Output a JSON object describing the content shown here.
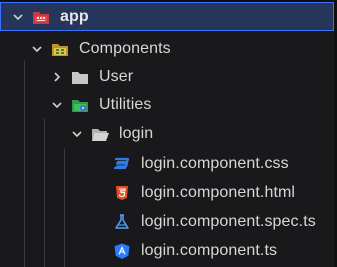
{
  "tree": {
    "root": {
      "label": "app",
      "icon": "app-folder-icon",
      "expanded": true
    },
    "components": {
      "label": "Components",
      "icon": "components-folder-icon",
      "expanded": true
    },
    "user": {
      "label": "User",
      "icon": "folder-icon",
      "expanded": false
    },
    "utilities": {
      "label": "Utilities",
      "icon": "utilities-folder-icon",
      "expanded": true
    },
    "login": {
      "label": "login",
      "icon": "open-folder-icon",
      "expanded": true
    },
    "files": [
      {
        "label": "login.component.css",
        "icon": "css-file-icon"
      },
      {
        "label": "login.component.html",
        "icon": "html-file-icon"
      },
      {
        "label": "login.component.spec.ts",
        "icon": "spec-test-file-icon"
      },
      {
        "label": "login.component.ts",
        "icon": "angular-file-icon"
      }
    ]
  },
  "colors": {
    "background": "#19191c",
    "selection": "#26365b",
    "selection_border": "#3a73ff",
    "text": "#d7d7d7",
    "app_red": "#e5484d",
    "folder_gray": "#c7c7c7",
    "components_yellow": "#d8b93a",
    "utilities_green": "#3fbf5e",
    "css_blue": "#2f7de1",
    "html_orange": "#e44d26",
    "spec_blue": "#4aa3ff",
    "angular_blue": "#2b7bff"
  }
}
